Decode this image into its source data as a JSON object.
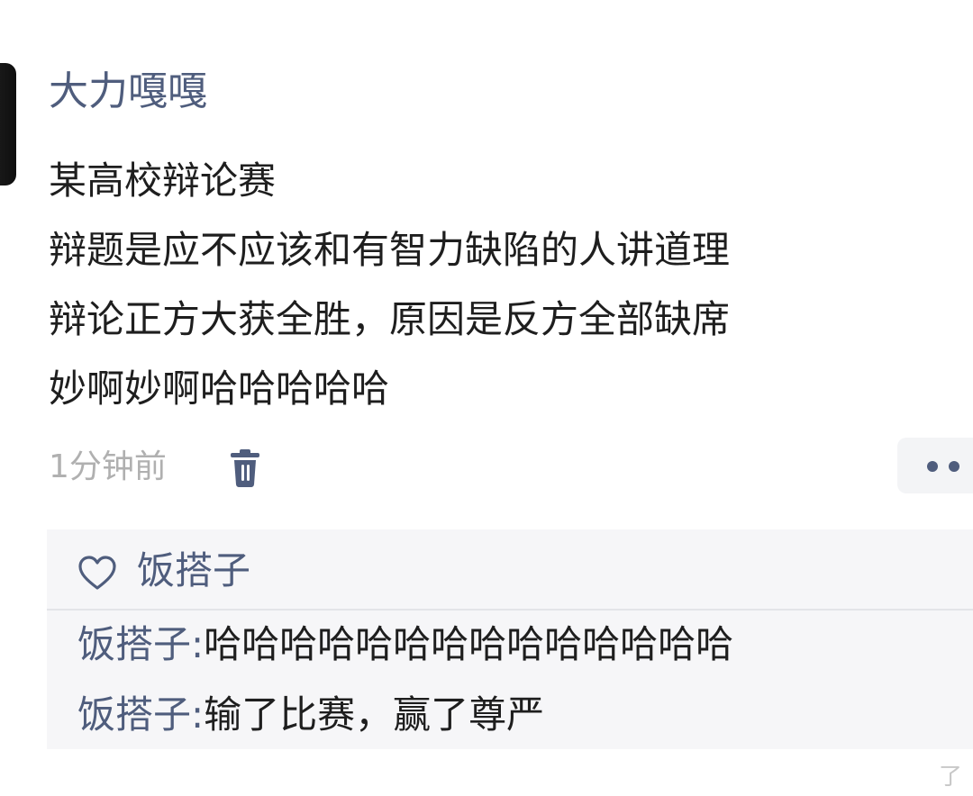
{
  "post": {
    "author": "大力嘎嘎",
    "lines": [
      "某高校辩论赛",
      "辩题是应不应该和有智力缺陷的人讲道理",
      "辩论正方大获全胜，原因是反方全部缺席",
      "妙啊妙啊哈哈哈哈哈"
    ],
    "time": "1分钟前",
    "delete_icon": "trash-icon",
    "more_icon": "more-dots-icon"
  },
  "likes": {
    "icon": "heart-outline-icon",
    "names": "饭搭子"
  },
  "comments": [
    {
      "user": "饭搭子",
      "separator": ":",
      "text": "哈哈哈哈哈哈哈哈哈哈哈哈哈哈"
    },
    {
      "user": "饭搭子",
      "separator": ":",
      "text": "输了比赛，赢了尊严"
    }
  ],
  "corner_text": "了",
  "colors": {
    "name_blue": "#4f5d7d",
    "body_text": "#1e1e1e",
    "meta_gray": "#b0b0b0",
    "comment_bg": "#f6f6f8"
  }
}
